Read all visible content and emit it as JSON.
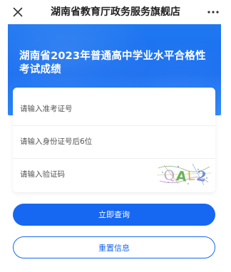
{
  "navbar": {
    "title": "湖南省教育厅政务服务旗舰店",
    "close_icon": "close-icon",
    "more_icon": "more-icon"
  },
  "hero": {
    "title": "湖南省2023年普通高中学业水平合格性考试成绩"
  },
  "form": {
    "exam_number": {
      "placeholder": "请输入准考证号",
      "value": ""
    },
    "id_last6": {
      "placeholder": "请输入身份证号后6位",
      "value": ""
    },
    "captcha": {
      "placeholder": "请输入验证码",
      "value": "",
      "image_text": "QAL2"
    }
  },
  "buttons": {
    "query_label": "立即查询",
    "reset_label": "重置信息"
  },
  "colors": {
    "brand_blue": "#1668f2",
    "hero_blue": "#1f78f0",
    "text_dark": "#222222"
  }
}
